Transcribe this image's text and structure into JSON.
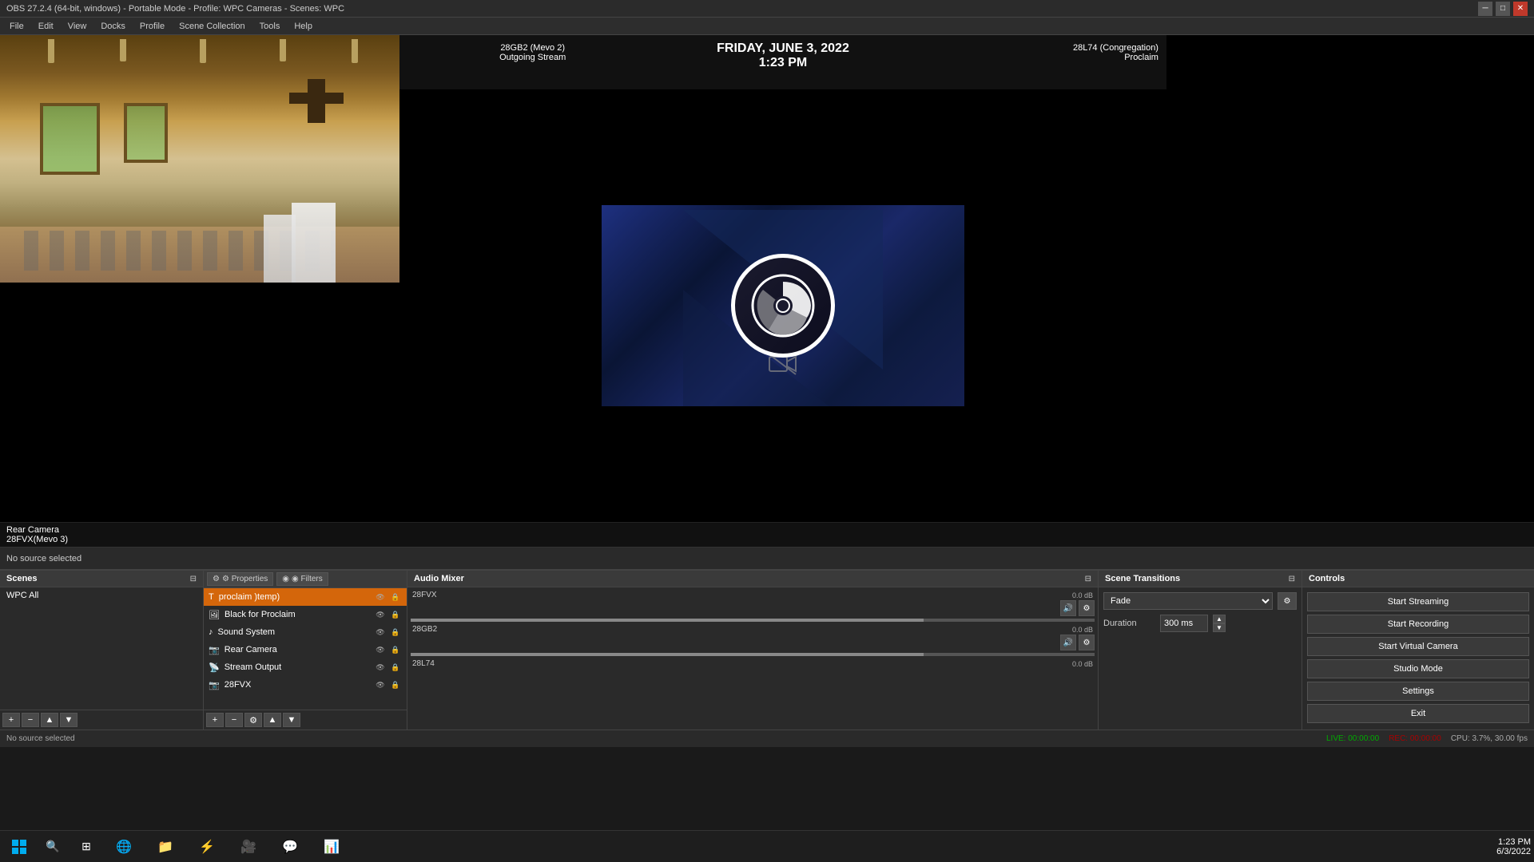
{
  "titlebar": {
    "title": "OBS 27.2.4 (64-bit, windows) - Portable Mode - Profile: WPC Cameras - Scenes: WPC",
    "minimize": "─",
    "restore": "□",
    "close": "✕"
  },
  "menubar": {
    "items": [
      "File",
      "Edit",
      "View",
      "Docks",
      "Profile",
      "Scene Collection",
      "Tools",
      "Help"
    ]
  },
  "preview": {
    "camera_label1": "Rear Camera",
    "camera_label2": "28FVX(Mevo 3)",
    "center_label1": "28GB2 (Mevo 2)",
    "center_label2": "Outgoing Stream",
    "right_label1": "28L74 (Congregation)",
    "right_label2": "Proclaim",
    "date_text": "FRIDAY, JUNE 3, 2022",
    "time_text": "1:23 PM"
  },
  "no_source_label": "No source selected",
  "scenes": {
    "header": "Scenes",
    "items": [
      "WPC All"
    ],
    "footer_buttons": [
      "+",
      "−",
      "▲",
      "▼"
    ]
  },
  "sources": {
    "properties_btn": "⚙ Properties",
    "filters_btn": "◉ Filters",
    "items": [
      {
        "name": "proclaim )temp)",
        "type": "text",
        "selected": true
      },
      {
        "name": "Black for Proclaim",
        "type": "image"
      },
      {
        "name": "Sound System",
        "type": "audio"
      },
      {
        "name": "Rear Camera",
        "type": "camera"
      },
      {
        "name": "Stream Output",
        "type": "stream"
      },
      {
        "name": "28FVX",
        "type": "camera"
      }
    ],
    "footer_buttons": [
      "+",
      "−",
      "⚙",
      "▲",
      "▼"
    ]
  },
  "audio_mixer": {
    "header": "Audio Mixer",
    "tracks": [
      {
        "name": "28FVX",
        "db": "0.0 dB",
        "level": 15
      },
      {
        "name": "28GB2",
        "db": "0.0 dB",
        "level": 12
      },
      {
        "name": "28L74",
        "db": "0.0 dB",
        "level": 10
      }
    ]
  },
  "scene_transitions": {
    "header": "Scene Transitions",
    "type_label": "Fade",
    "duration_label": "Duration",
    "duration_value": "300 ms",
    "settings_icon": "⚙"
  },
  "controls": {
    "header": "Controls",
    "start_streaming": "Start Streaming",
    "start_recording": "Start Recording",
    "start_virtual_camera": "Start Virtual Camera",
    "studio_mode": "Studio Mode",
    "settings": "Settings",
    "exit": "Exit"
  },
  "statusbar": {
    "no_source": "No source selected",
    "live_label": "LIVE:",
    "live_time": "00:00:00",
    "rec_label": "REC:",
    "rec_time": "00:00:00",
    "cpu": "CPU: 3.7%,",
    "fps": "30.00 fps"
  },
  "taskbar": {
    "time": "1:23 PM",
    "date": "6/3/2022"
  }
}
